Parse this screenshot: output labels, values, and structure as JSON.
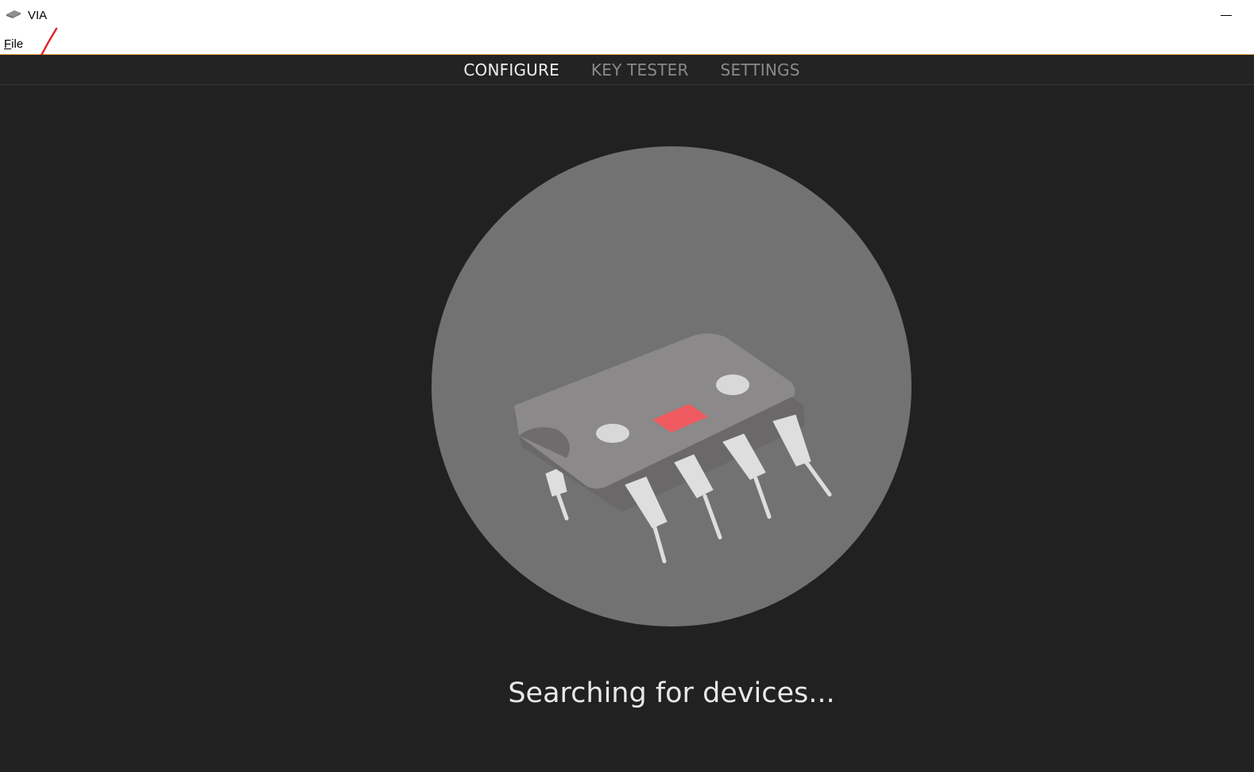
{
  "window": {
    "title": "VIA"
  },
  "menu": {
    "file_first": "F",
    "file_rest": "ile"
  },
  "nav": {
    "tabs": [
      {
        "label": "CONFIGURE",
        "active": true
      },
      {
        "label": "KEY TESTER",
        "active": false
      },
      {
        "label": "SETTINGS",
        "active": false
      }
    ]
  },
  "main": {
    "status": "Searching for devices..."
  },
  "colors": {
    "background": "#212121",
    "circle": "#727272",
    "chip_body": "#8b8989",
    "chip_led": "#ee5a5f",
    "accent_line": "#e8a23e"
  }
}
